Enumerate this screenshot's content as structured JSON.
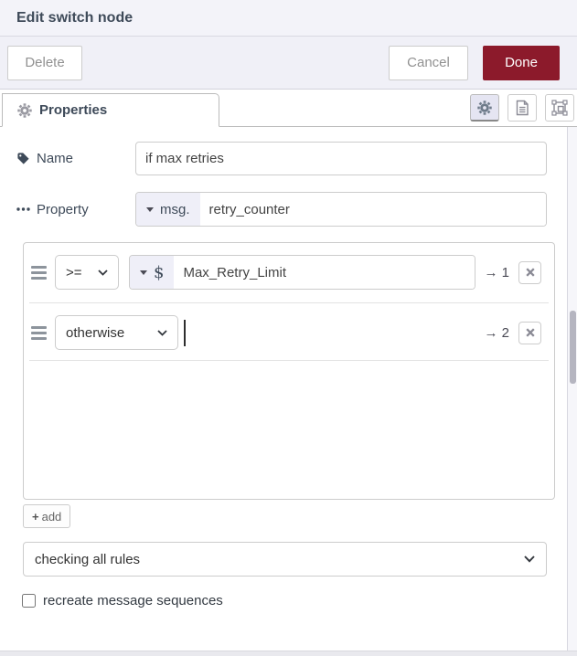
{
  "dialog": {
    "title": "Edit switch node",
    "buttons": {
      "delete": "Delete",
      "cancel": "Cancel",
      "done": "Done"
    },
    "tab_label": "Properties",
    "icons": {
      "tab": "gear-icon",
      "editor_toolbar": [
        "gear-icon",
        "document-icon",
        "appearance-selection-icon"
      ],
      "name_label": "tag-icon",
      "property_label": "ellipsis-icon",
      "rule_row": [
        "drag-handle-icon",
        "chevron-down-icon",
        "x-icon"
      ]
    },
    "colors": {
      "done_button_bg": "#8c1a2b",
      "header_bg": "#f3f3f9",
      "prefix_segment_bg": "#efeff8"
    }
  },
  "form": {
    "name": {
      "label": "Name",
      "value": "if max retries"
    },
    "property": {
      "label": "Property",
      "prefix": "msg.",
      "value": "retry_counter"
    },
    "rules": [
      {
        "operator": ">=",
        "prefix": "$",
        "value": "Max_Retry_Limit",
        "arrow": "→",
        "output": "1"
      },
      {
        "operator": "otherwise",
        "value": "",
        "arrow": "→",
        "output": "2"
      }
    ],
    "add_plus": "+",
    "add_label": "add",
    "mode_select": {
      "value": "checking all rules"
    },
    "recreate": {
      "label": "recreate message sequences",
      "checked": false
    }
  }
}
